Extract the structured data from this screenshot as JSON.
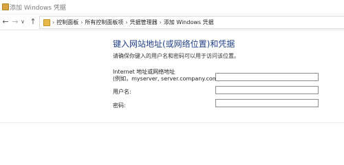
{
  "window": {
    "title": "添加 Windows 凭据"
  },
  "nav": {
    "back_icon": "back-arrow-icon",
    "forward_icon": "forward-arrow-icon",
    "recent_icon": "chevron-down-icon",
    "up_icon": "up-arrow-icon"
  },
  "breadcrumb": [
    "控制面板",
    "所有控制面板项",
    "凭据管理器",
    "添加 Windows 凭据"
  ],
  "form": {
    "heading": "键入网站地址(或网络位置)和凭据",
    "instruction": "请确保你键入的用户名和密码可以用于访问该位置。",
    "address_label_1": "Internet 地址或网络地址",
    "address_label_2": "(例如，myserver, server.company.com):",
    "address_value": "",
    "username_label": "用户名:",
    "username_value": "",
    "password_label": "密码:",
    "password_value": ""
  },
  "colors": {
    "heading": "#1f3f86"
  }
}
